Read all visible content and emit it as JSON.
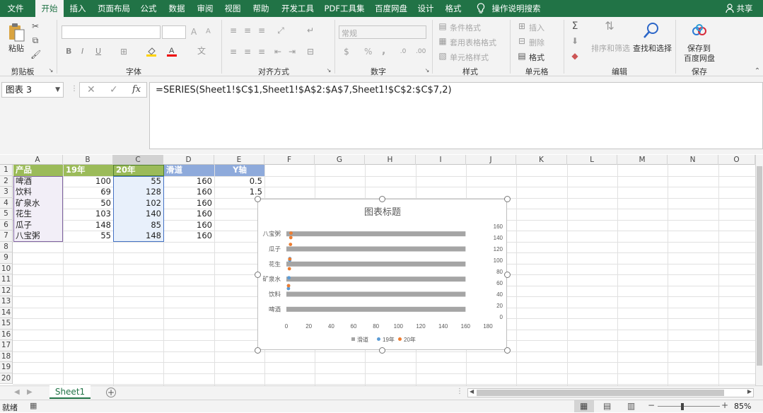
{
  "tabs": [
    "文件",
    "开始",
    "插入",
    "页面布局",
    "公式",
    "数据",
    "审阅",
    "视图",
    "帮助",
    "开发工具",
    "PDF工具集",
    "百度网盘",
    "设计",
    "格式"
  ],
  "tell_me": "操作说明搜索",
  "share": "共享",
  "ribbon": {
    "clipboard": {
      "paste": "粘贴",
      "label": "剪贴板"
    },
    "font": {
      "label": "字体",
      "bold": "B",
      "italic": "I",
      "underline": "U",
      "grow": "A",
      "shrink": "A"
    },
    "align": {
      "label": "对齐方式"
    },
    "number": {
      "label": "数字",
      "format": "常规",
      "percent": "%",
      "comma": ","
    },
    "styles": {
      "label": "样式",
      "cond": "条件格式",
      "table": "套用表格格式",
      "cell": "单元格样式"
    },
    "cells": {
      "label": "单元格",
      "insert": "插入",
      "delete": "删除",
      "format": "格式"
    },
    "edit": {
      "label": "编辑",
      "sort": "排序和筛选",
      "find": "查找和选择"
    },
    "save": {
      "label": "保存",
      "btn1": "保存到",
      "btn2": "百度网盘"
    }
  },
  "namebox": "图表 3",
  "formula": "=SERIES(Sheet1!$C$1,Sheet1!$A$2:$A$7,Sheet1!$C$2:$C$7,2)",
  "fx": "fx",
  "columns": [
    "A",
    "B",
    "C",
    "D",
    "E",
    "F",
    "G",
    "H",
    "I",
    "J",
    "K",
    "L",
    "M",
    "N",
    "O"
  ],
  "rows": [
    "1",
    "2",
    "3",
    "4",
    "5",
    "6",
    "7",
    "8",
    "9",
    "10",
    "11",
    "12",
    "13",
    "14",
    "15",
    "16",
    "17",
    "18",
    "19",
    "20"
  ],
  "header_row": [
    "产品",
    "19年",
    "20年",
    "滑道",
    "Y轴"
  ],
  "table": [
    [
      "啤酒",
      "100",
      "55",
      "160",
      "0.5"
    ],
    [
      "饮料",
      "69",
      "128",
      "160",
      "1.5"
    ],
    [
      "矿泉水",
      "50",
      "102",
      "160",
      "2"
    ],
    [
      "花生",
      "103",
      "140",
      "160",
      "3"
    ],
    [
      "瓜子",
      "148",
      "85",
      "160",
      "4"
    ],
    [
      "八宝粥",
      "55",
      "148",
      "160",
      "5"
    ]
  ],
  "chart_data": {
    "type": "bar",
    "title": "图表标题",
    "categories": [
      "啤酒",
      "饮料",
      "矿泉水",
      "花生",
      "瓜子",
      "八宝粥"
    ],
    "series": [
      {
        "name": "滑道",
        "values": [
          160,
          160,
          160,
          160,
          160,
          160
        ],
        "color": "#a5a5a5"
      },
      {
        "name": "19年",
        "values": [
          100,
          69,
          50,
          103,
          148,
          55
        ],
        "color": "#5b9bd5"
      },
      {
        "name": "20年",
        "values": [
          55,
          128,
          102,
          140,
          85,
          148
        ],
        "color": "#ed7d31"
      }
    ],
    "xticks": [
      "0",
      "20",
      "40",
      "60",
      "80",
      "100",
      "120",
      "140",
      "160",
      "180"
    ],
    "xlim": [
      0,
      180
    ],
    "y2ticks": [
      "0",
      "20",
      "40",
      "60",
      "80",
      "100",
      "120",
      "140",
      "160"
    ],
    "legend": "bottom"
  },
  "sheet_tab": "Sheet1",
  "status": "就绪",
  "zoom": "85%"
}
